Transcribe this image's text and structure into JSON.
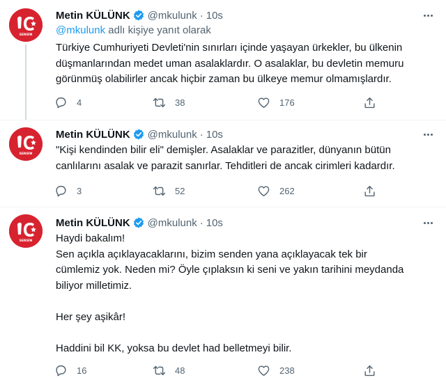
{
  "tweets": [
    {
      "name": "Metin KÜLÜNK",
      "handle": "@mkulunk",
      "separator": "·",
      "time": "10s",
      "replying_prefix": "@mkulunk",
      "replying_suffix": " adlı kişiye yanıt olarak",
      "lines": [
        "Türkiye Cumhuriyeti Devleti'nin sınırları içinde yaşayan ürkekler, bu ülkenin",
        "düşmanlarından medet uman asalaklardır. O asalaklar, bu devletin memuru",
        "görünmüş olabilirler ancak hiçbir zaman bu ülkeye memur olmamışlardır."
      ],
      "reply_count": "4",
      "retweet_count": "38",
      "like_count": "176"
    },
    {
      "name": "Metin KÜLÜNK",
      "handle": "@mkulunk",
      "separator": "·",
      "time": "10s",
      "lines": [
        "\"Kişi kendinden bilir eli\" demişler. Asalaklar ve parazitler, dünyanın bütün",
        "canlılarını asalak ve parazit sanırlar. Tehditleri de ancak cirimleri kadardır."
      ],
      "reply_count": "3",
      "retweet_count": "52",
      "like_count": "262"
    },
    {
      "name": "Metin KÜLÜNK",
      "handle": "@mkulunk",
      "separator": "·",
      "time": "10s",
      "lines": [
        "Haydi bakalım!",
        "Sen açıkla açıklayacaklarını, bizim senden yana açıklayacak tek bir",
        "cümlemiz yok. Neden mi? Öyle çıplaksın ki seni ve yakın tarihini  meydanda",
        "biliyor milletimiz.",
        "",
        "Her şey aşikâr!",
        "",
        "Haddini bil KK, yoksa bu devlet had belletmeyi bilir."
      ],
      "reply_count": "16",
      "retweet_count": "48",
      "like_count": "238"
    }
  ],
  "avatar_text": "SENSİN",
  "colors": {
    "accent": "#1d9bf0",
    "avatar_bg": "#d7232f",
    "muted": "#536471"
  }
}
